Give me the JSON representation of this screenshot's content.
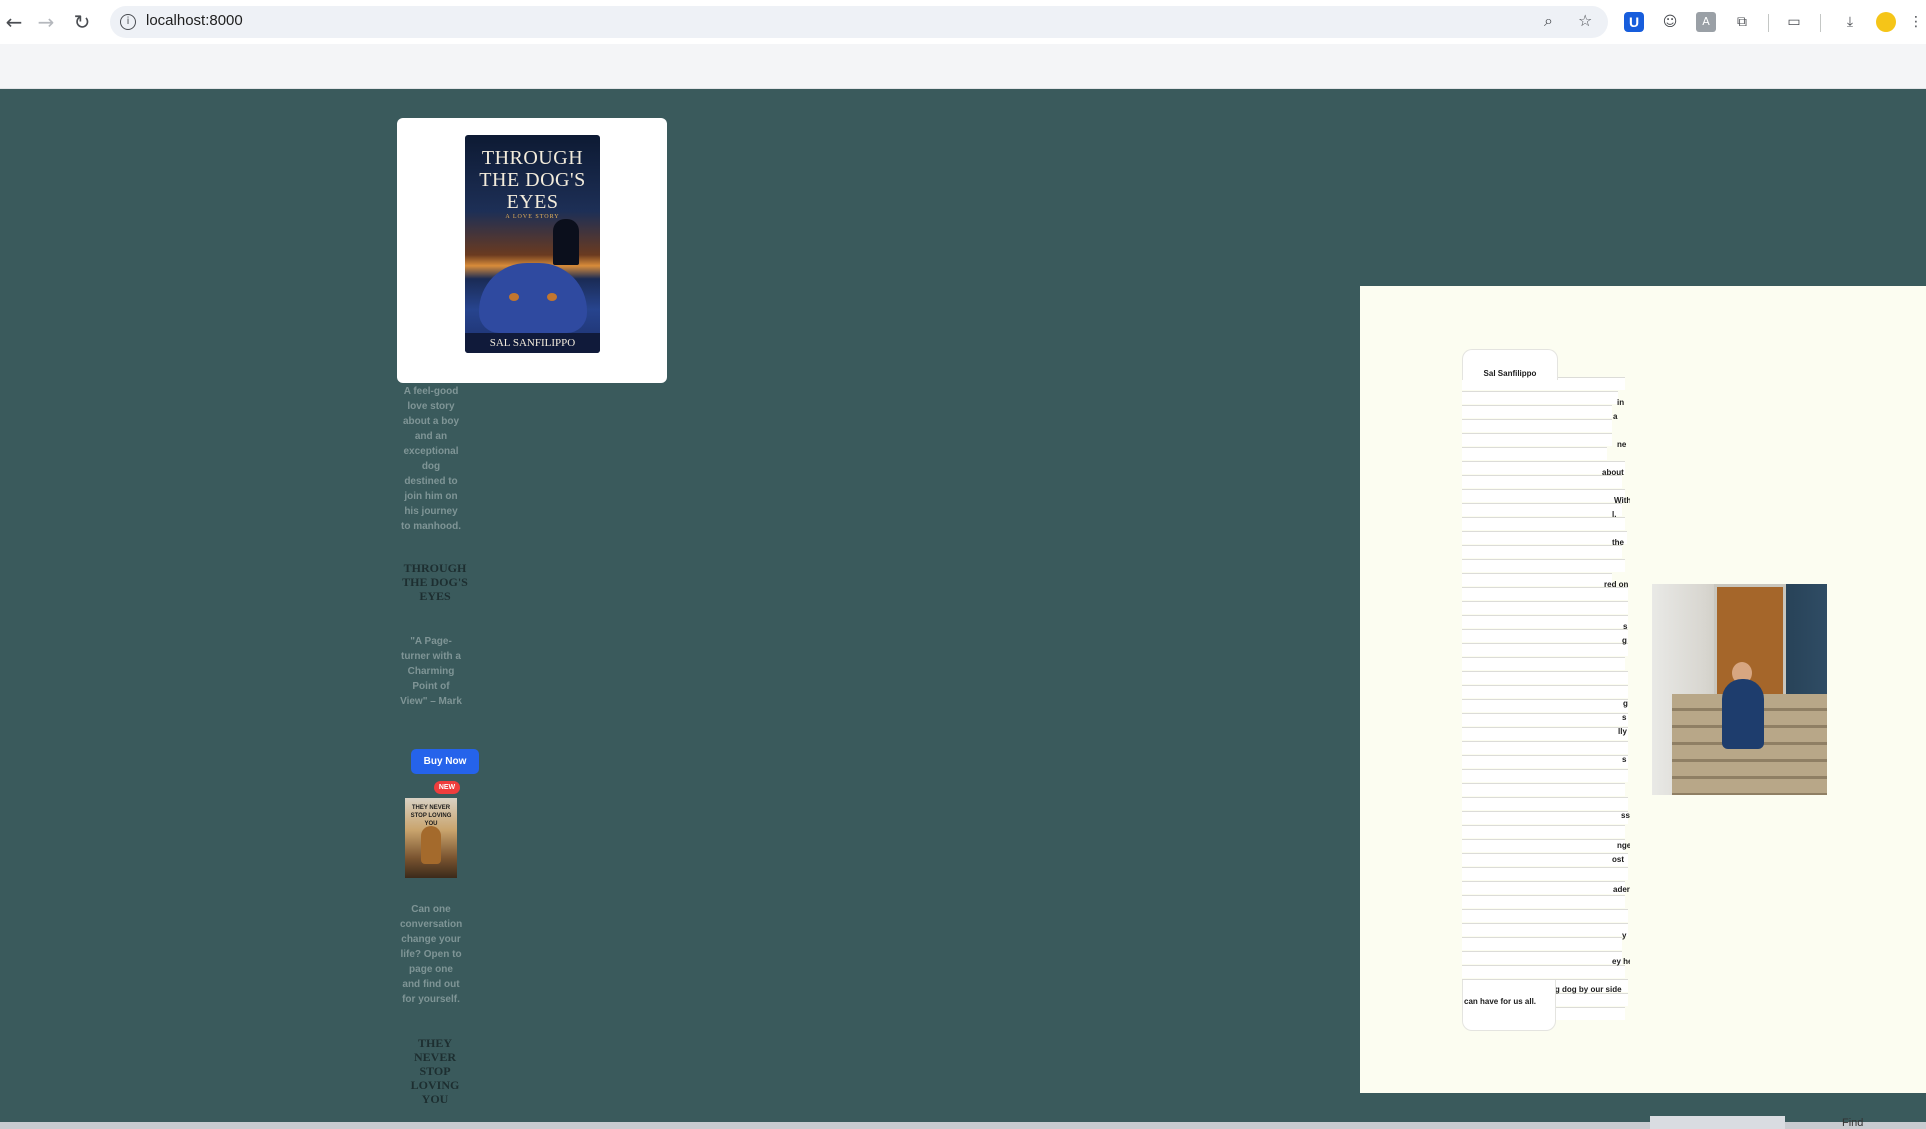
{
  "browser": {
    "url": "localhost:8000",
    "icons": [
      "back-icon",
      "forward-icon",
      "reload-icon",
      "site-info-icon",
      "zoom-icon",
      "bookmark-star-icon",
      "bitwarden-icon",
      "extension-robot-icon",
      "extension-gray-icon",
      "extensions-puzzle-icon",
      "media-icon",
      "download-icon",
      "profile-avatar-icon",
      "menu-icon"
    ]
  },
  "book1": {
    "cover_title": "THROUGH THE DOG'S EYES",
    "cover_subtitle": "A LOVE STORY",
    "cover_author": "SAL SANFILIPPO",
    "blurb": "A feel-good love story about a boy and an exceptional dog destined to join him on his journey to manhood.",
    "title": "THROUGH THE DOG'S EYES",
    "quote": "\"A Page-turner with a Charming Point of View\" – Mark",
    "buy_label": "Buy Now"
  },
  "book2": {
    "badge": "NEW",
    "cover_title": "THEY NEVER STOP LOVING YOU",
    "blurb": "Can one conversation change your life? Open to page one and find out for yourself.",
    "title": "THEY NEVER STOP LOVING YOU"
  },
  "article": {
    "tab_label": "Sal Sanfilippo",
    "fragments": [
      "in",
      "a",
      "ne",
      "about",
      "With",
      "l.",
      "the",
      "red on",
      "s",
      "g",
      "g",
      "s",
      "lly",
      "s",
      "ss",
      "nge",
      "ost",
      "ader",
      "y",
      "ey he",
      "ng dog by our side",
      "can have for us all."
    ]
  },
  "bottom": {
    "find_label": "Find"
  }
}
